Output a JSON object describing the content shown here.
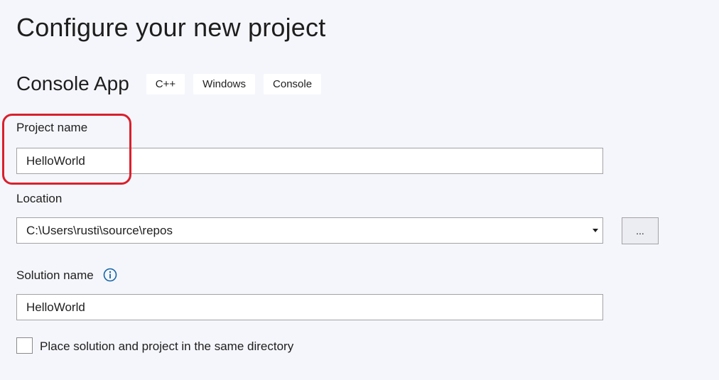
{
  "page": {
    "title": "Configure your new project"
  },
  "template": {
    "name": "Console App",
    "tags": [
      "C++",
      "Windows",
      "Console"
    ]
  },
  "project_name": {
    "label": "Project name",
    "value": "HelloWorld"
  },
  "location": {
    "label": "Location",
    "value": "C:\\Users\\rusti\\source\\repos",
    "browse_label": "..."
  },
  "solution_name": {
    "label": "Solution name",
    "value": "HelloWorld",
    "info_icon": "info-icon"
  },
  "same_directory": {
    "label": "Place solution and project in the same directory",
    "checked": false
  },
  "colors": {
    "background": "#f5f6fb",
    "highlight": "#d9202c",
    "info_icon": "#1565a8"
  }
}
